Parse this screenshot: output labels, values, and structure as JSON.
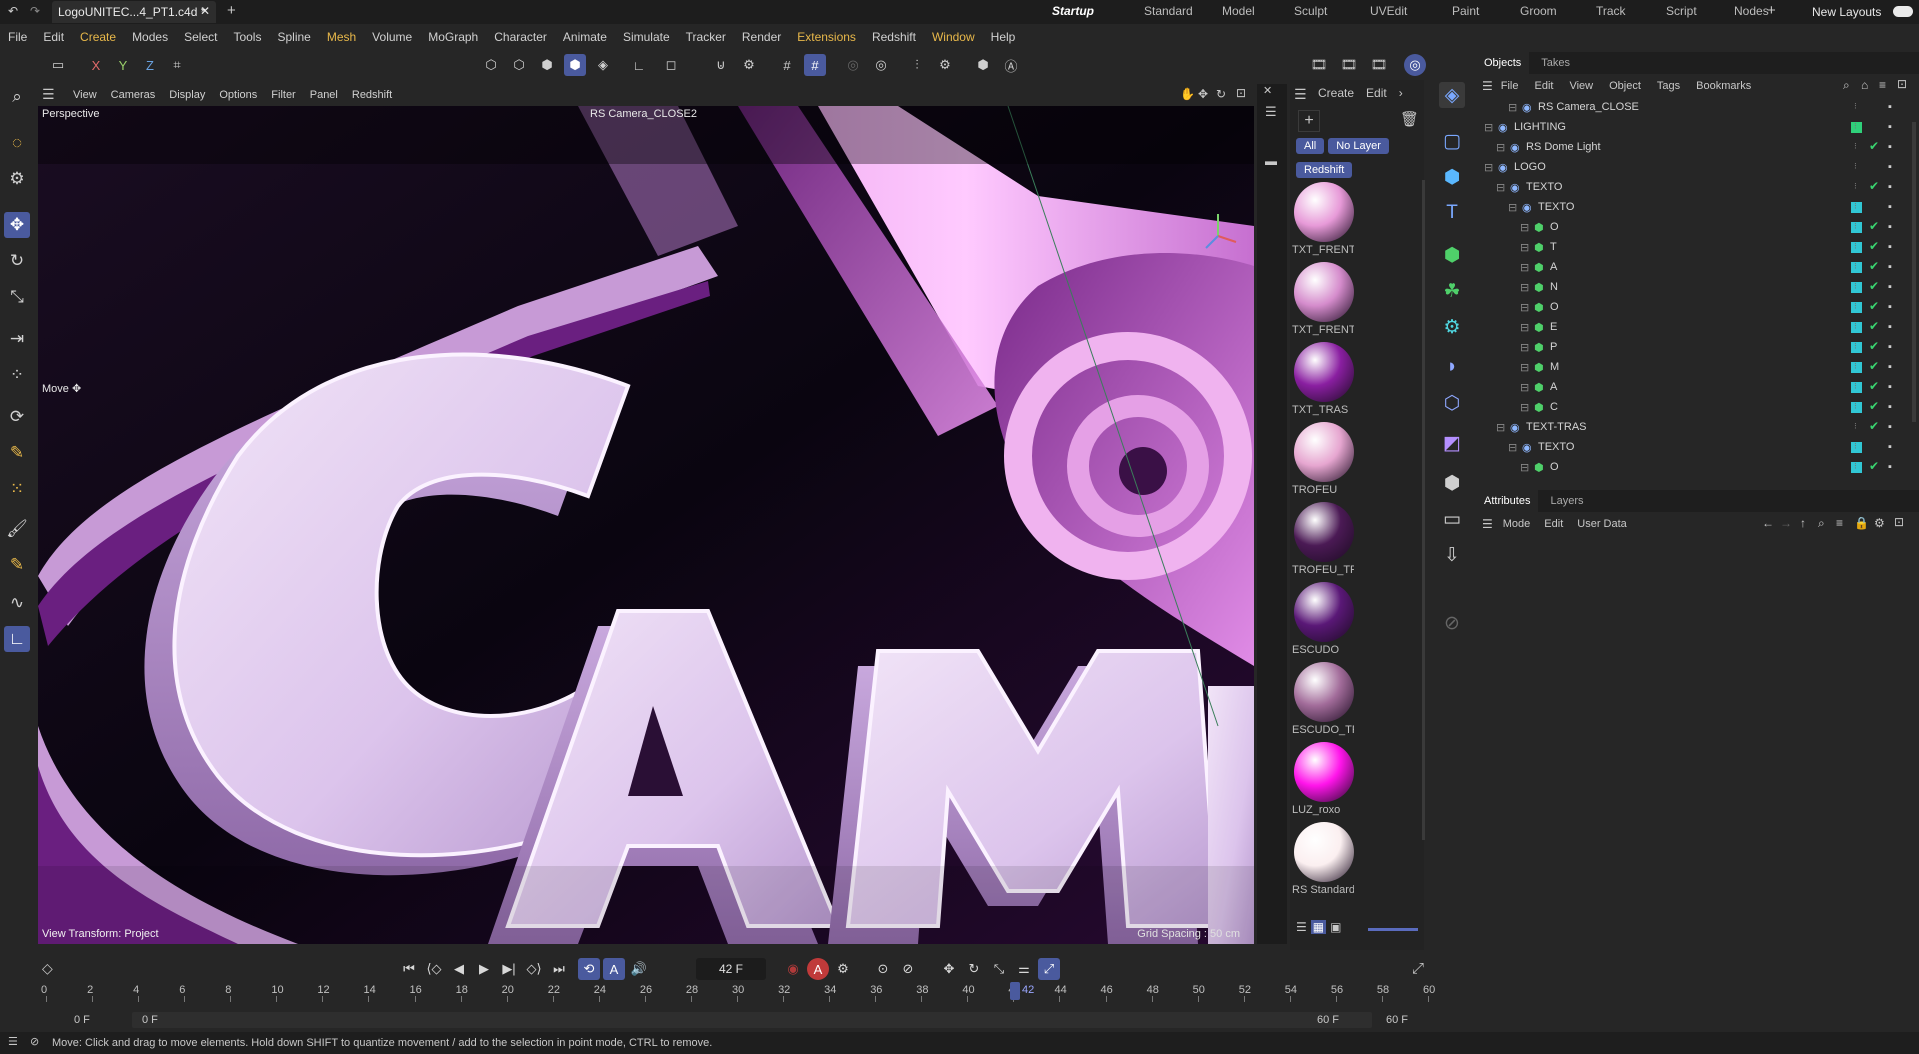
{
  "window": {
    "doc_tab": "LogoUNITEC...4_PT1.c4d *",
    "layout_tabs": [
      "Startup",
      "Standard",
      "Model",
      "Sculpt",
      "UVEdit",
      "Paint",
      "Groom",
      "Track",
      "Script",
      "Nodes"
    ],
    "active_layout": "Startup",
    "new_layouts": "New Layouts"
  },
  "menu": [
    "File",
    "Edit",
    "Create",
    "Modes",
    "Select",
    "Tools",
    "Spline",
    "Mesh",
    "Volume",
    "MoGraph",
    "Character",
    "Animate",
    "Simulate",
    "Tracker",
    "Render",
    "Extensions",
    "Redshift",
    "Window",
    "Help"
  ],
  "menu_highlight": [
    "Create",
    "Mesh",
    "Extensions",
    "Window"
  ],
  "axis_buttons": [
    "X",
    "Y",
    "Z"
  ],
  "viewport": {
    "menu": [
      "View",
      "Cameras",
      "Display",
      "Options",
      "Filter",
      "Panel",
      "Redshift"
    ],
    "projection": "Perspective",
    "camera": "RS Camera_CLOSE2",
    "tool_label": "Move",
    "view_transform": "View Transform: Project",
    "grid_spacing": "Grid Spacing : 50 cm",
    "logo_text": "CAMP"
  },
  "materials": {
    "menu": [
      "Create",
      "Edit"
    ],
    "filter_all": "All",
    "filter_nolayer": "No Layer",
    "renderer": "Redshift",
    "items": [
      {
        "name": "TXT_FRENTE",
        "color": "#e79ad8"
      },
      {
        "name": "TXT_FRENTE",
        "color": "#d58ccc"
      },
      {
        "name": "TXT_TRAS",
        "color": "#8a1fa1"
      },
      {
        "name": "TROFEU",
        "color": "#e6a6d0"
      },
      {
        "name": "TROFEU_TR",
        "color": "#4b1a55"
      },
      {
        "name": "ESCUDO",
        "color": "#5a1877"
      },
      {
        "name": "ESCUDO_TR",
        "color": "#a26c9a"
      },
      {
        "name": "LUZ_roxo",
        "color": "#ff14ea"
      },
      {
        "name": "RS Standard",
        "color": "#fbeff0"
      }
    ]
  },
  "objects": {
    "tabs": [
      "Objects",
      "Takes"
    ],
    "menu": [
      "File",
      "Edit",
      "View",
      "Object",
      "Tags",
      "Bookmarks"
    ],
    "rows": [
      {
        "name": "RS Camera_CLOSE",
        "indent": 2,
        "color": "none",
        "check": false
      },
      {
        "name": "LIGHTING",
        "indent": 0,
        "color": "#2fd07a",
        "check": false
      },
      {
        "name": "RS Dome Light",
        "indent": 1,
        "color": "none",
        "check": true
      },
      {
        "name": "LOGO",
        "indent": 0,
        "color": "none",
        "check": false
      },
      {
        "name": "TEXTO",
        "indent": 1,
        "color": "none",
        "check": true
      },
      {
        "name": "TEXTO",
        "indent": 2,
        "color": "#31c7d4",
        "check": false
      },
      {
        "name": "O",
        "indent": 3,
        "color": "#31c7d4",
        "check": true
      },
      {
        "name": "T",
        "indent": 3,
        "color": "#31c7d4",
        "check": true
      },
      {
        "name": "A",
        "indent": 3,
        "color": "#31c7d4",
        "check": true
      },
      {
        "name": "N",
        "indent": 3,
        "color": "#31c7d4",
        "check": true
      },
      {
        "name": "O",
        "indent": 3,
        "color": "#31c7d4",
        "check": true
      },
      {
        "name": "E",
        "indent": 3,
        "color": "#31c7d4",
        "check": true
      },
      {
        "name": "P",
        "indent": 3,
        "color": "#31c7d4",
        "check": true
      },
      {
        "name": "M",
        "indent": 3,
        "color": "#31c7d4",
        "check": true
      },
      {
        "name": "A",
        "indent": 3,
        "color": "#31c7d4",
        "check": true
      },
      {
        "name": "C",
        "indent": 3,
        "color": "#31c7d4",
        "check": true
      },
      {
        "name": "TEXT-TRAS",
        "indent": 1,
        "color": "none",
        "check": true
      },
      {
        "name": "TEXTO",
        "indent": 2,
        "color": "#31c7d4",
        "check": false
      },
      {
        "name": "O",
        "indent": 3,
        "color": "#31c7d4",
        "check": true
      }
    ]
  },
  "attributes": {
    "tabs": [
      "Attributes",
      "Layers"
    ],
    "menu": [
      "Mode",
      "Edit",
      "User Data"
    ]
  },
  "timeline": {
    "current_frame": "42 F",
    "ruler": [
      "0",
      "2",
      "4",
      "6",
      "8",
      "10",
      "12",
      "14",
      "16",
      "18",
      "20",
      "22",
      "24",
      "26",
      "28",
      "30",
      "32",
      "34",
      "36",
      "38",
      "40",
      "42",
      "44",
      "46",
      "48",
      "50",
      "52",
      "54",
      "56",
      "58",
      "60"
    ],
    "current_marker": "42",
    "start": "0 F",
    "start2": "0 F",
    "end": "60 F",
    "end2": "60 F"
  },
  "status": "Move: Click and drag to move elements. Hold down SHIFT to quantize movement / add to the selection in point mode, CTRL to remove."
}
